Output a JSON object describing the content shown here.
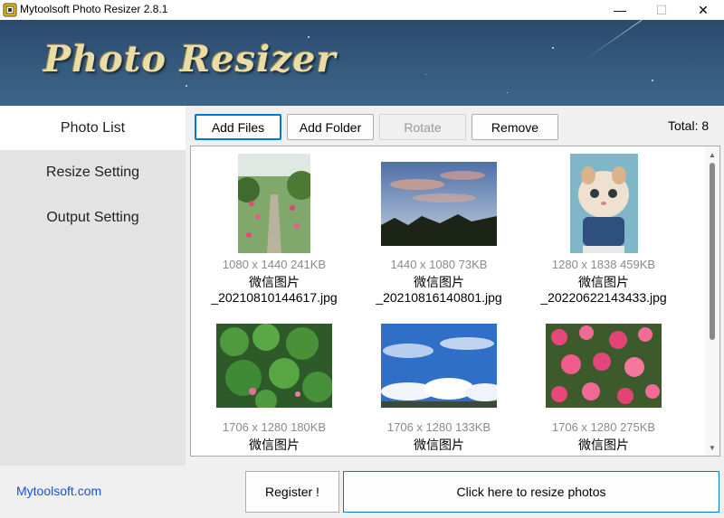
{
  "window": {
    "title": "Mytoolsoft Photo Resizer 2.8.1",
    "minimize_glyph": "—",
    "maximize_glyph": "☐",
    "close_glyph": "✕"
  },
  "banner": {
    "title": "Photo Resizer"
  },
  "sidebar": {
    "items": [
      {
        "label": "Photo List",
        "active": true
      },
      {
        "label": "Resize Setting",
        "active": false
      },
      {
        "label": "Output Setting",
        "active": false
      }
    ]
  },
  "toolbar": {
    "add_files": "Add Files",
    "add_folder": "Add Folder",
    "rotate": "Rotate",
    "remove": "Remove",
    "total": "Total: 8"
  },
  "photos": [
    {
      "meta": "1080 x 1440 241KB",
      "name_line1": "微信图片",
      "name_line2": "_20210810144617.jpg",
      "icon": "garden-path-photo"
    },
    {
      "meta": "1440 x 1080 73KB",
      "name_line1": "微信图片",
      "name_line2": "_20210816140801.jpg",
      "icon": "sunset-sky-photo"
    },
    {
      "meta": "1280 x 1838 459KB",
      "name_line1": "微信图片",
      "name_line2": "_20220622143433.jpg",
      "icon": "cat-photo"
    },
    {
      "meta": "1706 x 1280 180KB",
      "name_line1": "微信图片",
      "name_line2": "",
      "icon": "lotus-leaves-photo"
    },
    {
      "meta": "1706 x 1280 133KB",
      "name_line1": "微信图片",
      "name_line2": "",
      "icon": "blue-sky-clouds-photo"
    },
    {
      "meta": "1706 x 1280 275KB",
      "name_line1": "微信图片",
      "name_line2": "",
      "icon": "pink-roses-photo"
    }
  ],
  "footer": {
    "link": "Mytoolsoft.com",
    "register": "Register !",
    "resize": "Click here to resize photos"
  },
  "colors": {
    "accent": "#0078d7",
    "link": "#1a4fd6",
    "banner": "#345a7e",
    "banner_text": "#e9dca6"
  }
}
